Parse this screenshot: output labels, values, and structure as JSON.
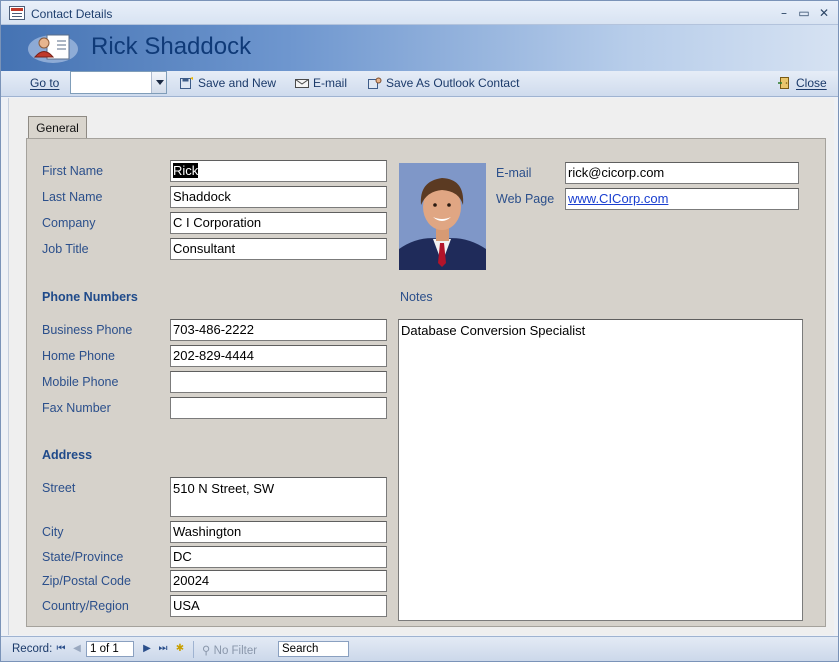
{
  "window": {
    "title": "Contact Details",
    "controls": {
      "minimize": "–",
      "restore": "▭",
      "close": "✕"
    }
  },
  "header": {
    "name": "Rick Shaddock"
  },
  "toolbar": {
    "goto_label": "Go to",
    "goto_value": "",
    "save_and_new": "Save and New",
    "email": "E-mail",
    "save_outlook": "Save As Outlook Contact",
    "close": "Close"
  },
  "tabs": [
    {
      "label": "General",
      "active": true
    }
  ],
  "form": {
    "labels": {
      "first_name": "First Name",
      "last_name": "Last Name",
      "company": "Company",
      "job_title": "Job Title",
      "email": "E-mail",
      "web_page": "Web Page",
      "phone_section": "Phone Numbers",
      "notes": "Notes",
      "business_phone": "Business Phone",
      "home_phone": "Home Phone",
      "mobile_phone": "Mobile Phone",
      "fax_number": "Fax Number",
      "address_section": "Address",
      "street": "Street",
      "city": "City",
      "state": "State/Province",
      "zip": "Zip/Postal Code",
      "country": "Country/Region"
    },
    "values": {
      "first_name": "Rick",
      "last_name": "Shaddock",
      "company": "C I Corporation",
      "job_title": "Consultant",
      "email": "rick@cicorp.com",
      "web_page": "www.CICorp.com",
      "business_phone": "703-486-2222",
      "home_phone": "202-829-4444",
      "mobile_phone": "",
      "fax_number": "",
      "street": "510 N Street, SW",
      "city": "Washington",
      "state": "DC",
      "zip": "20024",
      "country": "USA",
      "notes": "Database Conversion Specialist"
    }
  },
  "statusbar": {
    "record_label": "Record:",
    "record_value": "1 of 1",
    "filter": "No Filter",
    "search": "Search"
  },
  "colors": {
    "label": "#2b4f8b",
    "header_dark": "#4573b3",
    "panel": "#d6d2cb"
  }
}
